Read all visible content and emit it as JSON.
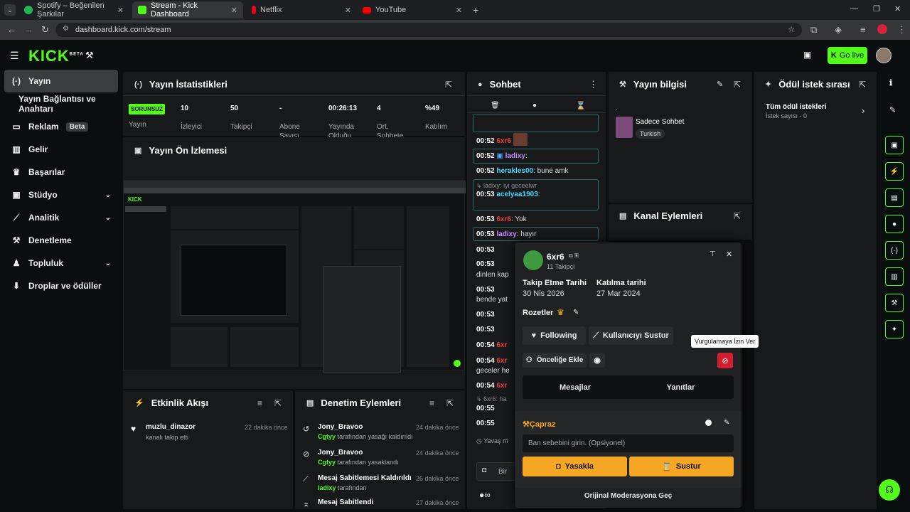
{
  "browser": {
    "tabs": [
      {
        "label": "Spotify – Beğenilen Şarkılar",
        "color": "#1db954"
      },
      {
        "label": "Stream - Kick Dashboard",
        "color": "#53fc18"
      },
      {
        "label": "Netflix",
        "color": "#e50914"
      },
      {
        "label": "YouTube",
        "color": "#ff0000"
      }
    ],
    "url": "dashboard.kick.com/stream"
  },
  "header": {
    "logo": "KICK",
    "logo_sup": "BETA",
    "golive": "Go live"
  },
  "sidebar": {
    "items": [
      {
        "label": "Yayın",
        "icon": "(·)"
      },
      {
        "label": "Yayın Bağlantısı ve Anahtarı",
        "icon": ""
      },
      {
        "label": "Reklam",
        "icon": "▭",
        "badge": "Beta"
      },
      {
        "label": "Gelir",
        "icon": "▥"
      },
      {
        "label": "Başarılar",
        "icon": "♛"
      },
      {
        "label": "Stüdyo",
        "icon": "▣"
      },
      {
        "label": "Analitik",
        "icon": "⟋"
      },
      {
        "label": "Denetleme",
        "icon": "⚒"
      },
      {
        "label": "Topluluk",
        "icon": "♟"
      },
      {
        "label": "Droplar ve ödüller",
        "icon": "⬇"
      }
    ]
  },
  "stats": {
    "title": "Yayın İstatistikleri",
    "status": "SORUNSUZ",
    "status_label": "Yayın",
    "items": [
      {
        "value": "10",
        "label": "İzleyici"
      },
      {
        "value": "50",
        "label": "Takipçi"
      },
      {
        "value": "-",
        "label": "Abone Sayısı"
      },
      {
        "value": "00:26:13",
        "label": "Yayında Olduğu"
      },
      {
        "value": "4",
        "label": "Ort. Sohbete"
      },
      {
        "value": "%49",
        "label": "Katılım"
      }
    ]
  },
  "preview": {
    "title": "Yayın Ön İzlemesi"
  },
  "activity": {
    "title": "Etkinlik Akışı",
    "items": [
      {
        "name": "muzlu_dinazor",
        "text": "kanalı takip etti",
        "time": "22 dakika önce"
      }
    ]
  },
  "moderation": {
    "title": "Denetim Eylemleri",
    "items": [
      {
        "name": "Jony_Bravoo",
        "actor": "Cgtyy",
        "text": "tarafından yasağı kaldırıldı",
        "time": "24 dakika önce"
      },
      {
        "name": "Jony_Bravoo",
        "actor": "Cgtyy",
        "text": "tarafından yasaklandı",
        "time": "24 dakika önce"
      },
      {
        "name": "Mesaj Sabitlemesi Kaldırıldı",
        "actor": "ladixy",
        "text": "tarafından",
        "time": "26 dakika önce"
      },
      {
        "name": "Mesaj Sabitlendi",
        "actor": "",
        "text": "",
        "time": "27 dakika önce"
      }
    ]
  },
  "chat": {
    "title": "Sohbet",
    "lines": [
      {
        "time": "00:52",
        "user": "6xr6",
        "msg": ""
      },
      {
        "time": "00:52",
        "user": "ladixy",
        "msg": ""
      },
      {
        "time": "00:52",
        "user": "herakles00",
        "msg": "bune amk"
      },
      {
        "time": "",
        "user": "ladixy",
        "msg": "iyi geceelwr"
      },
      {
        "time": "00:53",
        "user": "acelyaa1903",
        "msg": ""
      },
      {
        "time": "00:53",
        "user": "6xr6",
        "msg": "Yok"
      },
      {
        "time": "00:53",
        "user": "ladixy",
        "msg": "hayır"
      },
      {
        "time": "00:53",
        "user": "",
        "msg": ""
      },
      {
        "time": "",
        "user": "",
        "msg": "dinlen kap"
      },
      {
        "time": "00:53",
        "user": "",
        "msg": ""
      },
      {
        "time": "",
        "user": "",
        "msg": "bende yat"
      },
      {
        "time": "00:53",
        "user": "",
        "msg": ""
      },
      {
        "time": "00:53",
        "user": "",
        "msg": ""
      },
      {
        "time": "00:54",
        "user": "6xr",
        "msg": ""
      },
      {
        "time": "00:54",
        "user": "6xr",
        "msg": ""
      },
      {
        "time": "",
        "user": "",
        "msg": "geceler he"
      },
      {
        "time": "00:54",
        "user": "6xr",
        "msg": ""
      },
      {
        "time": "",
        "user": "6xr6:",
        "msg": "ha"
      },
      {
        "time": "00:55",
        "user": "",
        "msg": ""
      },
      {
        "time": "00:55",
        "user": "",
        "msg": ""
      },
      {
        "time": "",
        "user": "",
        "msg": "Yavaş m"
      }
    ],
    "input": "Bir"
  },
  "streaminfo": {
    "title": "Yayın bilgisi",
    "dot": ".",
    "stream_title": "Sadece Sohbet",
    "tag": "Turkish"
  },
  "channelactions": {
    "title": "Kanal Eylemleri"
  },
  "rewards": {
    "title": "Ödül istek sırası",
    "row_title": "Tüm ödül istekleri",
    "row_sub": "İstek sayısı - 0"
  },
  "usercard": {
    "username": "6xr6",
    "followers": "11 Takipçi",
    "follow_date_label": "Takip Etme Tarihi",
    "follow_date": "30 Nis 2026",
    "join_date_label": "Katılma tarihi",
    "join_date": "27 Mar 2024",
    "badges_label": "Rozetler",
    "following": "Following",
    "mute": "Kullanıcıyı Sustur",
    "priority": "Önceliğe Ekle",
    "tooltip": "Vurgulamaya İzin Ver",
    "tab_messages": "Mesajlar",
    "tab_replies": "Yanıtlar",
    "section": "Çapraz",
    "ban_placeholder": "Ban sebebini girin. (Opsiyonel)",
    "ban_btn": "Yasakla",
    "mute_btn": "Sustur",
    "footer": "Orijinal Moderasyona Geç"
  }
}
